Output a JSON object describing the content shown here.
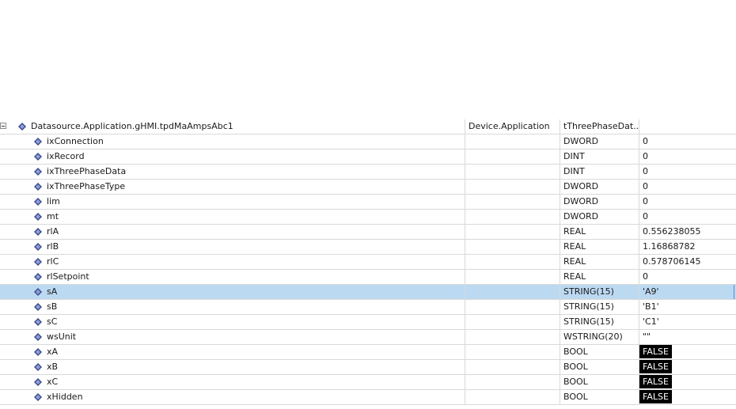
{
  "root": {
    "name": "Datasource.Application.gHMI.tpdMaAmpsAbc1",
    "device": "Device.Application",
    "type": "tThreePhaseDat..."
  },
  "children": [
    {
      "name": "ixConnection",
      "type": "DWORD",
      "value": "0",
      "bool": false,
      "selected": false
    },
    {
      "name": "ixRecord",
      "type": "DINT",
      "value": "0",
      "bool": false,
      "selected": false
    },
    {
      "name": "ixThreePhaseData",
      "type": "DINT",
      "value": "0",
      "bool": false,
      "selected": false
    },
    {
      "name": "ixThreePhaseType",
      "type": "DWORD",
      "value": "0",
      "bool": false,
      "selected": false
    },
    {
      "name": "lim",
      "type": "DWORD",
      "value": "0",
      "bool": false,
      "selected": false
    },
    {
      "name": "mt",
      "type": "DWORD",
      "value": "0",
      "bool": false,
      "selected": false
    },
    {
      "name": "rlA",
      "type": "REAL",
      "value": "0.556238055",
      "bool": false,
      "selected": false
    },
    {
      "name": "rlB",
      "type": "REAL",
      "value": "1.16868782",
      "bool": false,
      "selected": false
    },
    {
      "name": "rlC",
      "type": "REAL",
      "value": "0.578706145",
      "bool": false,
      "selected": false
    },
    {
      "name": "rlSetpoint",
      "type": "REAL",
      "value": "0",
      "bool": false,
      "selected": false
    },
    {
      "name": "sA",
      "type": "STRING(15)",
      "value": "'A9'",
      "bool": false,
      "selected": true
    },
    {
      "name": "sB",
      "type": "STRING(15)",
      "value": "'B1'",
      "bool": false,
      "selected": false
    },
    {
      "name": "sC",
      "type": "STRING(15)",
      "value": "'C1'",
      "bool": false,
      "selected": false
    },
    {
      "name": "wsUnit",
      "type": "WSTRING(20)",
      "value": "\"\"",
      "bool": false,
      "selected": false
    },
    {
      "name": "xA",
      "type": "BOOL",
      "value": "FALSE",
      "bool": true,
      "selected": false
    },
    {
      "name": "xB",
      "type": "BOOL",
      "value": "FALSE",
      "bool": true,
      "selected": false
    },
    {
      "name": "xC",
      "type": "BOOL",
      "value": "FALSE",
      "bool": true,
      "selected": false
    },
    {
      "name": "xHidden",
      "type": "BOOL",
      "value": "FALSE",
      "bool": true,
      "selected": false
    }
  ],
  "colors": {
    "selection": "#bcd9f2",
    "icon": "#3b4a8c",
    "bool_bg": "#000000",
    "bool_fg": "#ffffff"
  },
  "icons": {
    "expander": "collapse-box-icon",
    "variable": "variable-icon"
  }
}
